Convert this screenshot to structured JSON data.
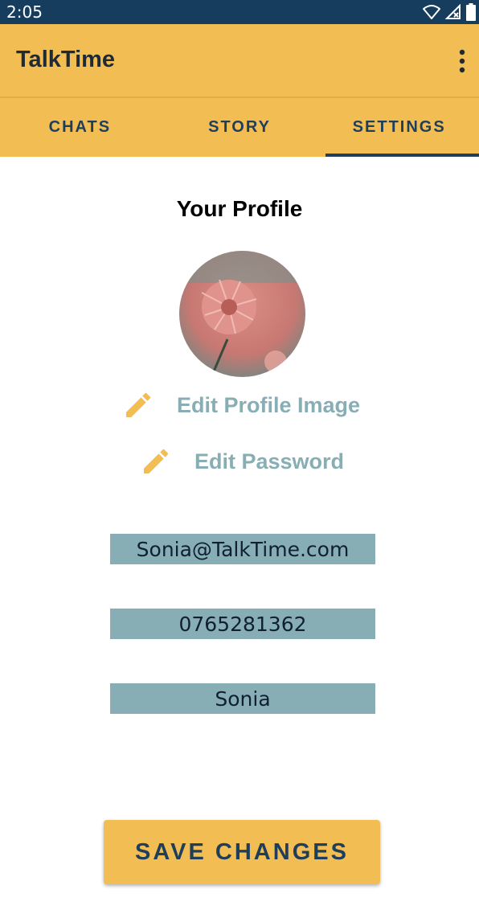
{
  "status_bar": {
    "time": "2:05",
    "icons": [
      "wifi-icon",
      "signal-icon",
      "battery-icon"
    ]
  },
  "app_bar": {
    "title": "TalkTime",
    "menu_icon": "overflow-menu-icon"
  },
  "tabs": [
    {
      "label": "CHATS",
      "selected": false
    },
    {
      "label": "STORY",
      "selected": false
    },
    {
      "label": "SETTINGS",
      "selected": true
    }
  ],
  "profile": {
    "title": "Your Profile",
    "avatar_icon": "profile-image",
    "edit_image_label": "Edit Profile Image",
    "edit_password_label": "Edit Password"
  },
  "fields": {
    "email": "Sonia@TalkTime.com",
    "phone": "0765281362",
    "name": "Sonia"
  },
  "save_button_label": "SAVE CHANGES",
  "colors": {
    "status_bar": "#173d5e",
    "primary": "#f2bd52",
    "tab_text": "#1e3e5c",
    "accent_text": "#87aeb5",
    "field_background": "#87aeb5"
  }
}
